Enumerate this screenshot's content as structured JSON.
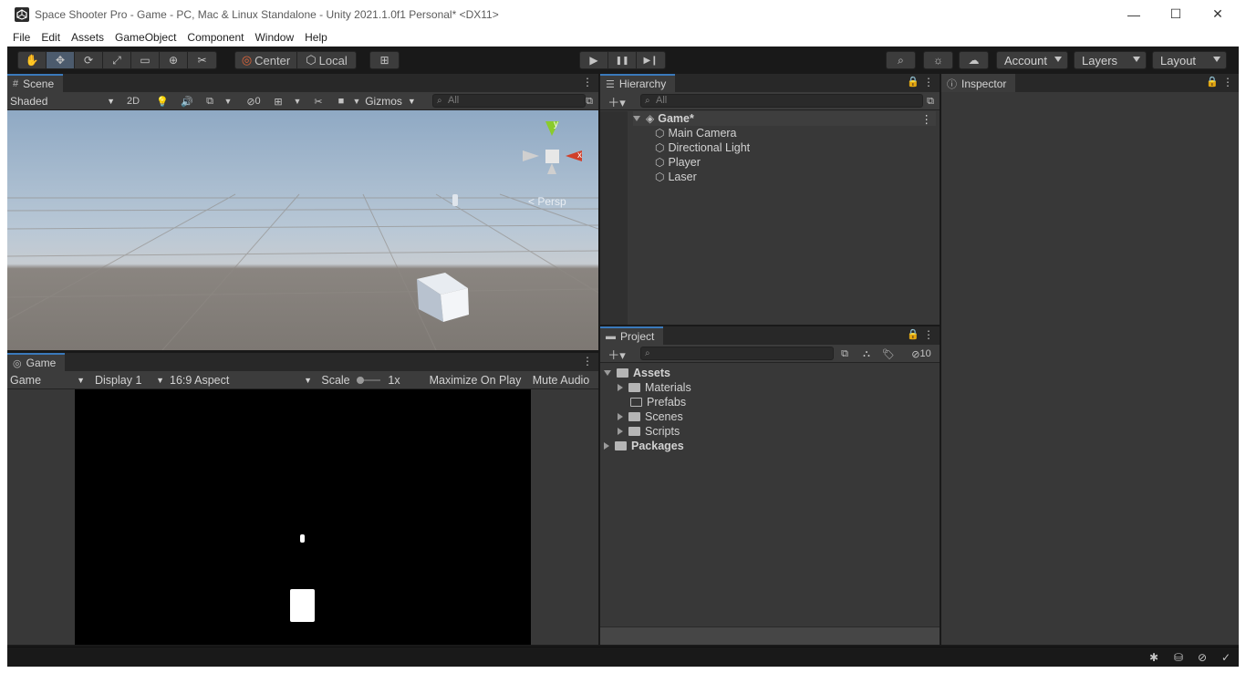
{
  "window": {
    "title": "Space Shooter Pro - Game - PC, Mac & Linux Standalone - Unity 2021.1.0f1 Personal* <DX11>",
    "minimize": "—",
    "maximize": "☐",
    "close": "✕"
  },
  "menu": [
    "File",
    "Edit",
    "Assets",
    "GameObject",
    "Component",
    "Window",
    "Help"
  ],
  "toolbar": {
    "tools": [
      "hand-tool",
      "move-tool",
      "rotate-tool",
      "scale-tool",
      "rect-tool",
      "transform-tool",
      "custom-tool"
    ],
    "pivot_mode": "Center",
    "pivot_rotation": "Local",
    "grid_snap": "⊞",
    "play": "▶",
    "pause": "❚❚",
    "step": "▶❙",
    "account": "Account",
    "layers": "Layers",
    "layout": "Layout"
  },
  "scene": {
    "tab": "Scene",
    "shading": "Shaded",
    "mode2d": "2D",
    "hidden_count": "0",
    "gizmos": "Gizmos",
    "search_placeholder": "All",
    "persp_label": "< Persp",
    "axis_y": "y",
    "axis_x": "x"
  },
  "game": {
    "tab": "Game",
    "view": "Game",
    "display": "Display 1",
    "aspect": "16:9 Aspect",
    "scale_label": "Scale",
    "scale_value": "1x",
    "maximize": "Maximize On Play",
    "mute": "Mute Audio"
  },
  "hierarchy": {
    "tab": "Hierarchy",
    "search_placeholder": "All",
    "scene": "Game*",
    "items": [
      "Main Camera",
      "Directional Light",
      "Player",
      "Laser"
    ]
  },
  "project": {
    "tab": "Project",
    "hidden_count": "10",
    "assets": "Assets",
    "folders": [
      "Materials",
      "Prefabs",
      "Scenes",
      "Scripts"
    ],
    "packages": "Packages"
  },
  "inspector": {
    "tab": "Inspector"
  },
  "colors": {
    "accent": "#3a79bb",
    "panel": "#383838",
    "toolbar": "#191919"
  }
}
